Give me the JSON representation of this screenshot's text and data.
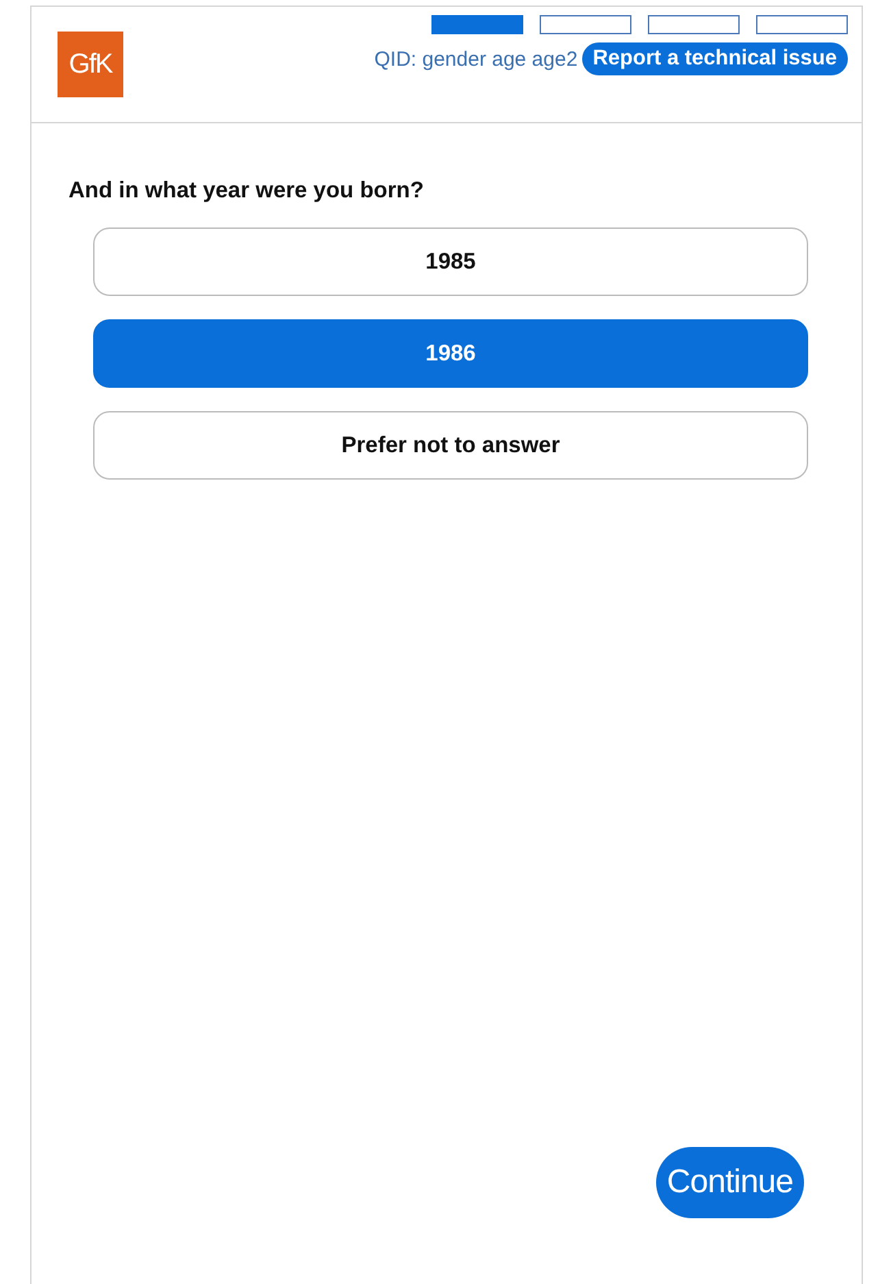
{
  "header": {
    "logo": "GfK",
    "progress": [
      {
        "filled": true
      },
      {
        "filled": false
      },
      {
        "filled": false
      },
      {
        "filled": false
      }
    ],
    "qid": "QID: gender age age2",
    "report_button": "Report a technical issue"
  },
  "question": "And in what year were you born?",
  "options": [
    {
      "label": "1985",
      "selected": false
    },
    {
      "label": "1986",
      "selected": true
    },
    {
      "label": "Prefer not to answer",
      "selected": false
    }
  ],
  "continue_button": "Continue"
}
